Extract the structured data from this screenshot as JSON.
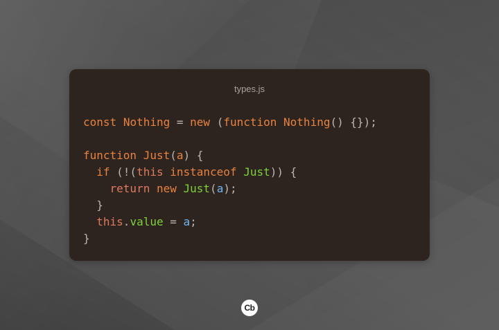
{
  "window": {
    "title": "types.js"
  },
  "code": {
    "lines": [
      [
        {
          "text": "const",
          "type": "keyword"
        },
        {
          "text": " ",
          "type": "punct"
        },
        {
          "text": "Nothing",
          "type": "name"
        },
        {
          "text": " = ",
          "type": "punct"
        },
        {
          "text": "new",
          "type": "keyword"
        },
        {
          "text": " (",
          "type": "punct"
        },
        {
          "text": "function",
          "type": "keyword"
        },
        {
          "text": " ",
          "type": "punct"
        },
        {
          "text": "Nothing",
          "type": "name"
        },
        {
          "text": "() {});",
          "type": "punct"
        }
      ],
      [],
      [
        {
          "text": "function",
          "type": "keyword"
        },
        {
          "text": " ",
          "type": "punct"
        },
        {
          "text": "Just",
          "type": "name"
        },
        {
          "text": "(",
          "type": "punct"
        },
        {
          "text": "a",
          "type": "param"
        },
        {
          "text": ") {",
          "type": "punct"
        }
      ],
      [
        {
          "text": "  ",
          "type": "punct"
        },
        {
          "text": "if",
          "type": "ctrl"
        },
        {
          "text": " (!(",
          "type": "punct"
        },
        {
          "text": "this",
          "type": "this"
        },
        {
          "text": " ",
          "type": "punct"
        },
        {
          "text": "instanceof",
          "type": "keyword"
        },
        {
          "text": " ",
          "type": "punct"
        },
        {
          "text": "Just",
          "type": "green"
        },
        {
          "text": ")) {",
          "type": "punct"
        }
      ],
      [
        {
          "text": "    ",
          "type": "punct"
        },
        {
          "text": "return",
          "type": "this"
        },
        {
          "text": " ",
          "type": "punct"
        },
        {
          "text": "new",
          "type": "keyword"
        },
        {
          "text": " ",
          "type": "punct"
        },
        {
          "text": "Just",
          "type": "green"
        },
        {
          "text": "(",
          "type": "punct"
        },
        {
          "text": "a",
          "type": "var"
        },
        {
          "text": ");",
          "type": "punct"
        }
      ],
      [
        {
          "text": "  }",
          "type": "punct"
        }
      ],
      [
        {
          "text": "  ",
          "type": "punct"
        },
        {
          "text": "this",
          "type": "this"
        },
        {
          "text": ".",
          "type": "punct"
        },
        {
          "text": "value",
          "type": "green"
        },
        {
          "text": " = ",
          "type": "punct"
        },
        {
          "text": "a",
          "type": "var"
        },
        {
          "text": ";",
          "type": "punct"
        }
      ],
      [
        {
          "text": "}",
          "type": "punct"
        }
      ]
    ]
  },
  "logo": {
    "text": "Cb",
    "icon": "carbon-logo-icon"
  },
  "colors": {
    "background": "#565656",
    "window_background": "#2d241f",
    "keyword": "#e8823f",
    "this_keyword": "#e07a5f",
    "identifier_green": "#7fd13b",
    "variable_blue": "#6fb6f2",
    "punctuation": "#bdb6b0"
  }
}
